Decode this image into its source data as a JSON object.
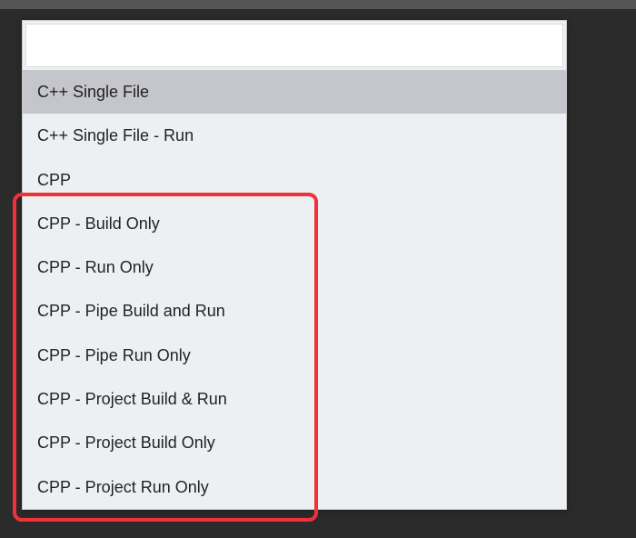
{
  "search": {
    "value": "",
    "placeholder": ""
  },
  "options": [
    {
      "label": "C++ Single File",
      "selected": true
    },
    {
      "label": "C++ Single File - Run",
      "selected": false
    },
    {
      "label": "CPP",
      "selected": false
    },
    {
      "label": "CPP - Build Only",
      "selected": false
    },
    {
      "label": "CPP - Run Only",
      "selected": false
    },
    {
      "label": "CPP - Pipe Build and Run",
      "selected": false
    },
    {
      "label": "CPP - Pipe Run Only",
      "selected": false
    },
    {
      "label": "CPP - Project Build & Run",
      "selected": false
    },
    {
      "label": "CPP - Project Build Only",
      "selected": false
    },
    {
      "label": "CPP - Project Run Only",
      "selected": false
    }
  ],
  "annotation": {
    "highlighted_indices": [
      3,
      4,
      5,
      6,
      7,
      8,
      9
    ],
    "box_color": "#f2303a"
  }
}
